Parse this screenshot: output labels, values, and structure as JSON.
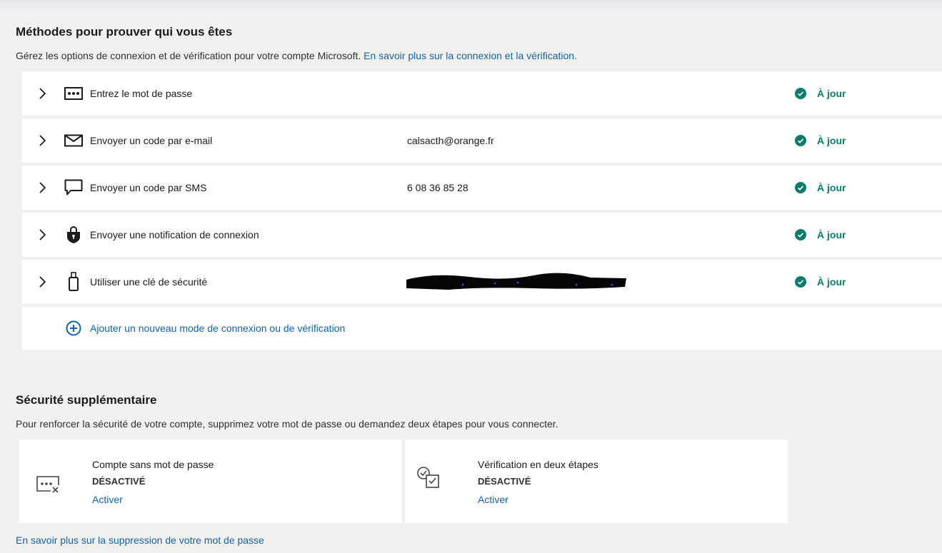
{
  "methods_section": {
    "title": "Méthodes pour prouver qui vous êtes",
    "description": "Gérez les options de connexion et de vérification pour votre compte Microsoft.",
    "learn_more": "En savoir plus sur la connexion et la vérification.",
    "items": [
      {
        "label": "Entrez le mot de passe",
        "value": "",
        "status": "À jour",
        "icon": "password-dots-icon"
      },
      {
        "label": "Envoyer un code par e-mail",
        "value": "calsacth@orange.fr",
        "status": "À jour",
        "icon": "envelope-icon"
      },
      {
        "label": "Envoyer un code par SMS",
        "value": "6 08 36 85 28",
        "status": "À jour",
        "icon": "chat-bubble-icon"
      },
      {
        "label": "Envoyer une notification de connexion",
        "value": "",
        "status": "À jour",
        "icon": "lock-shield-icon"
      },
      {
        "label": "Utiliser une clé de sécurité",
        "value": "",
        "status": "À jour",
        "icon": "usb-key-icon"
      }
    ],
    "add_method": "Ajouter un nouveau mode de connexion ou de vérification"
  },
  "security_section": {
    "title": "Sécurité supplémentaire",
    "description": "Pour renforcer la sécurité de votre compte, supprimez votre mot de passe ou demandez deux étapes pour vous connecter.",
    "cards": [
      {
        "title": "Compte sans mot de passe",
        "state": "DÉSACTIVÉ",
        "action": "Activer",
        "icon": "passwordless-icon"
      },
      {
        "title": "Vérification en deux étapes",
        "state": "DÉSACTIVÉ",
        "action": "Activer",
        "icon": "two-step-verification-icon"
      }
    ],
    "learn_more": "En savoir plus sur la suppression de votre mot de passe"
  },
  "colors": {
    "accent_link": "#0f62ad",
    "status_green": "#0a7c6c",
    "background": "#f2f1f0",
    "card": "#ffffff"
  }
}
